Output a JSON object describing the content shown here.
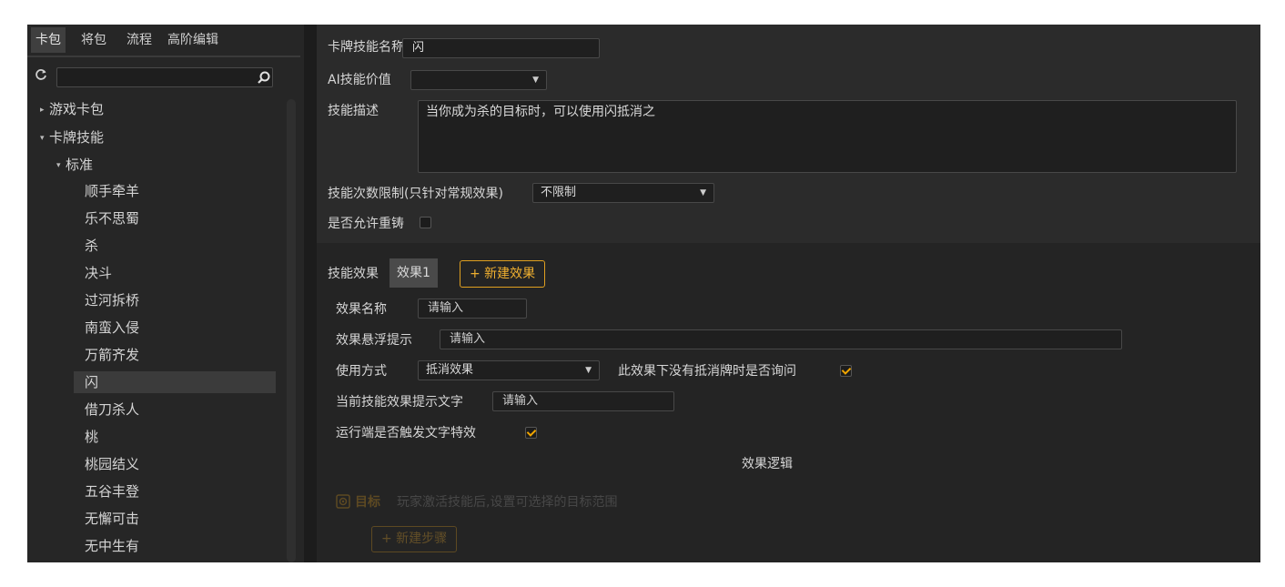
{
  "left": {
    "tabs": [
      {
        "label": "卡包",
        "active": true
      },
      {
        "label": "将包",
        "active": false
      },
      {
        "label": "流程",
        "active": false
      },
      {
        "label": "高阶编辑",
        "active": false
      }
    ],
    "search": {
      "value": "",
      "placeholder": ""
    },
    "tree": {
      "group1": "游戏卡包",
      "group2": "卡牌技能",
      "subgroup": "标准",
      "leaves": [
        "顺手牵羊",
        "乐不思蜀",
        "杀",
        "决斗",
        "过河拆桥",
        "南蛮入侵",
        "万箭齐发",
        "闪",
        "借刀杀人",
        "桃",
        "桃园结义",
        "五谷丰登",
        "无懈可击",
        "无中生有"
      ],
      "selected": "闪"
    }
  },
  "skill": {
    "name_label": "卡牌技能名称",
    "name_value": "闪",
    "ai_label": "AI技能价值",
    "ai_value": "",
    "desc_label": "技能描述",
    "desc_value": "当你成为杀的目标时，可以使用闪抵消之",
    "limit_label": "技能次数限制(只针对常规效果)",
    "limit_value": "不限制",
    "recast_label": "是否允许重铸",
    "recast_checked": false
  },
  "effects": {
    "label": "技能效果",
    "tab": "效果1",
    "new_button": "+ 新建效果",
    "name_label": "效果名称",
    "name_placeholder": "请输入",
    "tooltip_label": "效果悬浮提示",
    "tooltip_placeholder": "请输入",
    "usage_label": "使用方式",
    "usage_value": "抵消效果",
    "ask_label": "此效果下没有抵消牌时是否询问",
    "ask_checked": true,
    "hint_label": "当前技能效果提示文字",
    "hint_placeholder": "请输入",
    "trigger_label": "运行端是否触发文字特效",
    "trigger_checked": true,
    "logic_title": "效果逻辑",
    "target_label": "目标",
    "target_desc": "玩家激活技能后,设置可选择的目标范围",
    "new_step_button": "+ 新建步骤"
  },
  "colors": {
    "accent": "#e0a020",
    "panel": "#2b2b2b",
    "background": "#1c1c1c"
  }
}
